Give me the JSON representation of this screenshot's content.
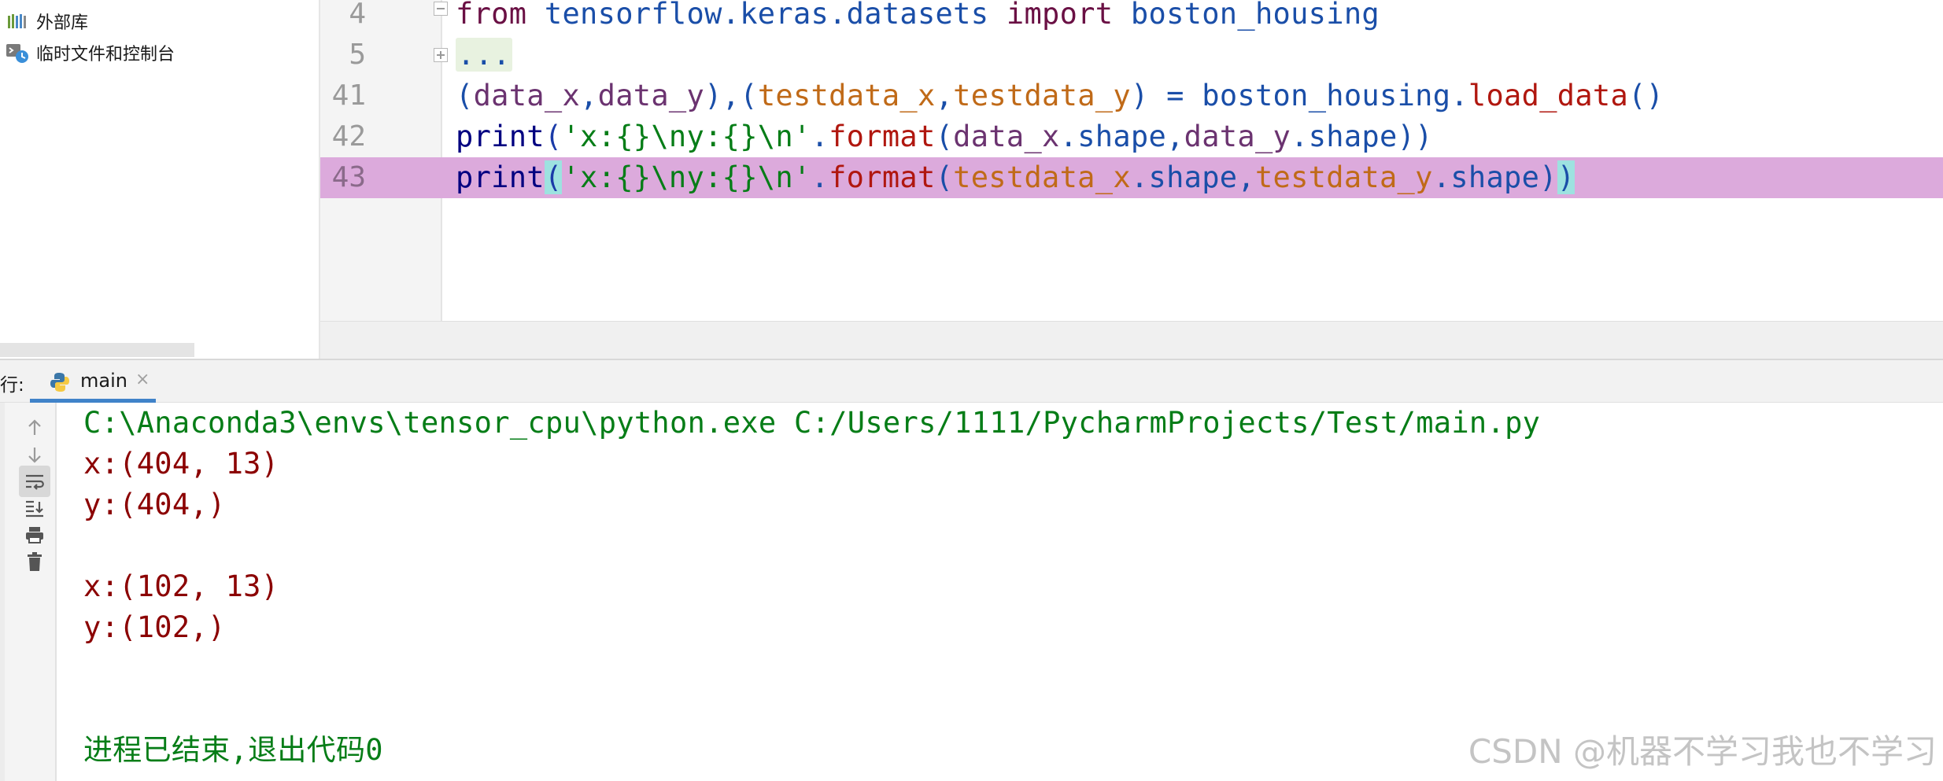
{
  "project_tree": {
    "items": [
      {
        "label": "外部库",
        "icon": "library-icon"
      },
      {
        "label": "临时文件和控制台",
        "icon": "scratches-icon"
      }
    ]
  },
  "editor": {
    "lines": [
      {
        "number": "4"
      },
      {
        "number": "5"
      },
      {
        "number": "41"
      },
      {
        "number": "42"
      },
      {
        "number": "43"
      }
    ],
    "tokens": {
      "l4": [
        "from",
        " tensorflow.keras.datasets ",
        "import",
        " boston_housing"
      ],
      "l5": [
        "..."
      ],
      "l41": [
        "(",
        "data_x",
        ",",
        "data_y",
        "),(",
        "testdata_x",
        ",",
        "testdata_y",
        ") = ",
        "boston_housing",
        ".",
        "load_data",
        "()"
      ],
      "l42": [
        "print",
        "(",
        "'x:{}\\ny:{}\\n'",
        ".",
        "format",
        "(",
        "data_x",
        ".shape,",
        "data_y",
        ".shape))"
      ],
      "l43": [
        "print",
        "(",
        "'x:{}\\ny:{}\\n'",
        ".",
        "format",
        "(",
        "testdata_x",
        ".shape,",
        "testdata_y",
        ".shape)",
        ")"
      ]
    },
    "highlight_color": "#dcaadc"
  },
  "run_panel": {
    "label": "行:",
    "tab": {
      "label": "main",
      "icon": "python-icon",
      "close": "×"
    },
    "toolbar": [
      "arrow-up-icon",
      "arrow-down-icon",
      "soft-wrap-icon",
      "scroll-to-end-icon",
      "print-icon",
      "trash-icon"
    ],
    "console": {
      "command": "C:\\Anaconda3\\envs\\tensor_cpu\\python.exe C:/Users/1111/PycharmProjects/Test/main.py",
      "output": [
        "x:(404, 13)",
        "y:(404,)",
        "",
        "x:(102, 13)",
        "y:(102,)"
      ],
      "exit_message": "进程已结束,退出代码0"
    }
  },
  "watermark": "CSDN @机器不学习我也不学习"
}
